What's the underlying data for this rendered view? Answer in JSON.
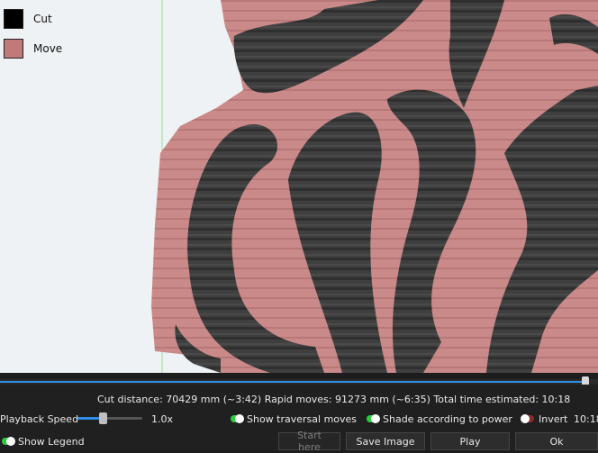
{
  "legend": {
    "items": [
      {
        "label": "Cut",
        "color": "#000000"
      },
      {
        "label": "Move",
        "color": "#c07a7a"
      }
    ]
  },
  "preview": {
    "cut_color": "#3c3c3c",
    "move_color": "#c98a89",
    "guide_line_color": "#7ed67e",
    "background_color": "#eef2f4"
  },
  "playback": {
    "progress": 0.985,
    "speed_label": "Playback Speed",
    "speed_value": "1.0x",
    "speed_fraction": 0.38
  },
  "stats": {
    "text": "Cut distance: 70429 mm (~3:42)   Rapid moves: 91273 mm (~6:35)   Total time estimated: 10:18"
  },
  "options": {
    "show_traversal": {
      "label": "Show traversal moves",
      "on": true
    },
    "shade_power": {
      "label": "Shade according to power",
      "on": true
    },
    "invert": {
      "label": "Invert",
      "on": false
    },
    "show_legend": {
      "label": "Show Legend",
      "on": true
    }
  },
  "time_display": "10:18",
  "buttons": {
    "start_here": "Start here",
    "save_image": "Save Image",
    "play": "Play",
    "ok": "Ok"
  }
}
